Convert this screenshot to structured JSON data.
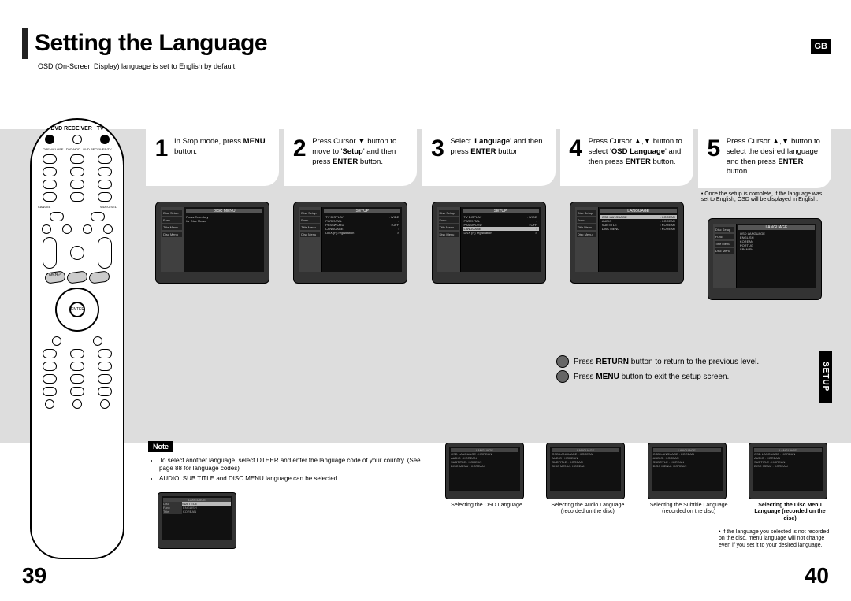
{
  "header": {
    "title": "Setting the Language",
    "badge": "GB",
    "subtitle": "OSD (On-Screen Display) language is set to English by default."
  },
  "steps": [
    {
      "num": "1",
      "html": "In Stop mode, press <b>MENU</b> button."
    },
    {
      "num": "2",
      "html": "Press Cursor ▼ button to move to '<b>Setup</b>' and then press <b>ENTER</b> button."
    },
    {
      "num": "3",
      "html": "Select '<b>Language</b>' and then press <b>ENTER</b> button"
    },
    {
      "num": "4",
      "html": "Press Cursor ▲,▼ button to select '<b>OSD Language</b>' and then press <b>ENTER</b> button."
    },
    {
      "num": "5",
      "html": "Press Cursor ▲,▼ button to select the desired language and then press <b>ENTER</b> button."
    }
  ],
  "step5_note": "• Once the setup is complete, if the language was set to English, OSD will be displayed in English.",
  "tv_menus": {
    "side": [
      "Disc Setup",
      "Func",
      "Title Menu",
      "Disc Menu"
    ],
    "s1": {
      "title": "DISC MENU",
      "lines": [
        "Press Enter key",
        "for Disc Menu"
      ]
    },
    "s2": {
      "title": "SETUP",
      "rows": [
        [
          "TV DISPLAY",
          ": WIDE"
        ],
        [
          "PARENTAL",
          ":"
        ],
        [
          "PASSWORD",
          ": OFF"
        ],
        [
          "LANGUAGE",
          ":"
        ],
        [
          "DivX (R) registration",
          ">"
        ]
      ]
    },
    "s3": {
      "title": "SETUP",
      "hl": 3,
      "rows": [
        [
          "TV DISPLAY",
          ": WIDE"
        ],
        [
          "PARENTAL",
          ":"
        ],
        [
          "PASSWORD",
          ": OFF"
        ],
        [
          "LANGUAGE",
          ":"
        ],
        [
          "DivX (R) registration",
          ">"
        ]
      ]
    },
    "s4": {
      "title": "LANGUAGE",
      "hl": 0,
      "rows": [
        [
          "OSD LANGUAGE",
          ": KOREAN"
        ],
        [
          "AUDIO",
          ": KOREAN"
        ],
        [
          "SUBTITLE",
          ": KOREAN"
        ],
        [
          "DISC MENU",
          ": KOREAN"
        ]
      ]
    },
    "s5": {
      "title": "LANGUAGE",
      "rows": [
        [
          "OSD LANGUAGE",
          ""
        ],
        [
          "  ENGLISH",
          ""
        ],
        [
          "  KOREAN",
          ""
        ],
        [
          "  PORTUG",
          ""
        ],
        [
          "  SPANISH",
          ""
        ]
      ]
    }
  },
  "bullets": [
    {
      "html": "Press <b>RETURN</b> button to return to the previous level."
    },
    {
      "html": "Press <b>MENU</b> button to exit the setup screen."
    }
  ],
  "side_tab": "SETUP",
  "note": {
    "label": "Note",
    "items": [
      "To select another language, select OTHER and enter the language code of your country. (See page 88 for language codes)",
      "AUDIO, SUB TITLE and DISC MENU language can be selected."
    ]
  },
  "lower_captions": [
    "Selecting the OSD Language",
    "Selecting the Audio Language (recorded on the disc)",
    "Selecting the Subtitle Language (recorded on the disc)",
    "Selecting the Disc Menu Language (recorded on the disc)"
  ],
  "lower_note": "• If the language you selected is not recorded on the disc, menu language will not change even if you set it to your desired language.",
  "page_left": "39",
  "page_right": "40",
  "remote_enter": "ENTER"
}
